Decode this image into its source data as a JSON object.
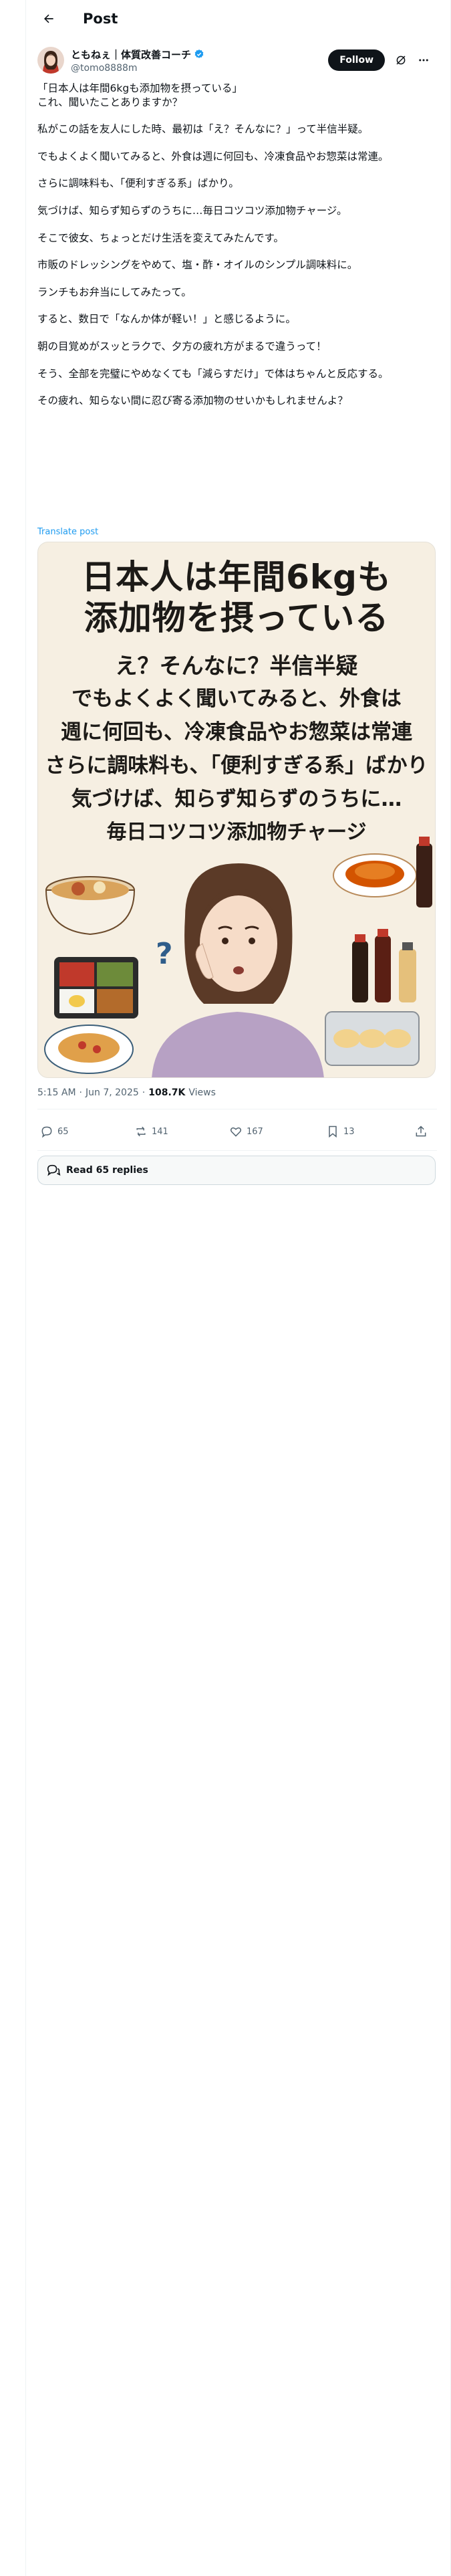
{
  "header": {
    "title": "Post"
  },
  "author": {
    "display_name": "ともねぇ｜体質改善コーチ",
    "handle": "@tomo8888m",
    "follow_label": "Follow"
  },
  "post": {
    "paragraphs": [
      [
        "「日本人は年間6kgも添加物を摂っている」",
        "これ、聞いたことありますか？"
      ],
      [
        "私がこの話を友人にした時、最初は「え？そんなに？」って半信半疑。"
      ],
      [
        "でもよくよく聞いてみると、外食は週に何回も、冷凍食品やお惣菜は常連。"
      ],
      [
        "さらに調味料も、「便利すぎる系」ばかり。"
      ],
      [
        "気づけば、知らず知らずのうちに…毎日コツコツ添加物チャージ。"
      ],
      [
        "そこで彼女、ちょっとだけ生活を変えてみたんです。"
      ],
      [
        "市販のドレッシングをやめて、塩・酢・オイルのシンプル調味料に。"
      ],
      [
        "ランチもお弁当にしてみたって。"
      ],
      [
        "すると、数日で「なんか体が軽い！」と感じるように。"
      ],
      [
        "朝の目覚めがスッとラクで、夕方の疲れ方がまるで違うって！"
      ],
      [
        "そう、全部を完璧にやめなくても「減らすだけ」で体はちゃんと反応する。"
      ],
      [
        "その疲れ、知らない間に忍び寄る添加物のせいかもしれませんよ？"
      ]
    ],
    "translate_label": "Translate post"
  },
  "media": {
    "title_line1": "日本人は年間6kgも",
    "title_line2": "添加物を摂っている",
    "lines": [
      "え？そんなに？半信半疑",
      "でもよくよく聞いてみると、外食は",
      "週に何回も、冷凍食品やお惣菜は常連",
      "さらに調味料も、「便利すぎる系」ばかり",
      "気づけば、知らず知らずのうちに…",
      "毎日コツコツ添加物チャージ"
    ]
  },
  "meta": {
    "time": "5:15 AM",
    "separator": "·",
    "date": "Jun 7, 2025",
    "views_count": "108.7K",
    "views_label": "Views"
  },
  "actions": {
    "replies": "65",
    "reposts": "141",
    "likes": "167",
    "bookmarks": "13"
  },
  "read_replies_label": "Read 65 replies",
  "colors": {
    "accent": "#1d9bf0",
    "text": "#0f1419",
    "muted": "#536471",
    "poster_bg": "#f6efe2"
  }
}
